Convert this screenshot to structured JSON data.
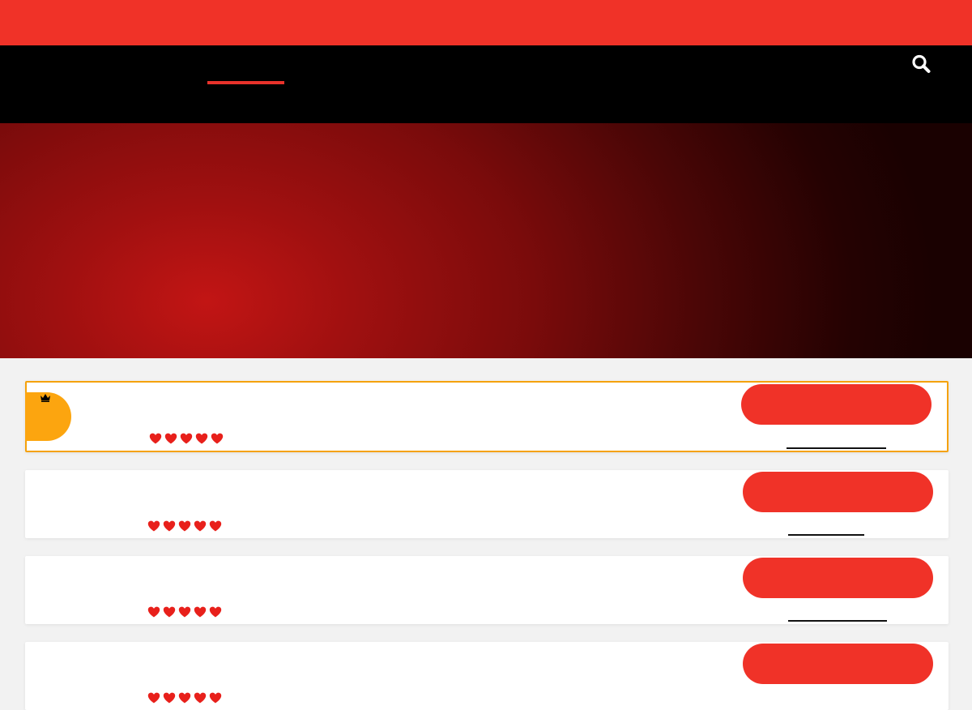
{
  "colors": {
    "brand_red": "#f03228",
    "nav_black": "#000000",
    "featured_gold": "#f5a20b",
    "badge_orange": "#fca50f",
    "heart_red": "#e8201b"
  },
  "header": {
    "search_icon": "search-icon"
  },
  "listings": [
    {
      "featured": true,
      "badge_icon": "crown-icon",
      "rating": 5,
      "rating_icon": "heart-icon"
    },
    {
      "featured": false,
      "rating": 5,
      "rating_icon": "heart-icon"
    },
    {
      "featured": false,
      "rating": 5,
      "rating_icon": "heart-icon"
    },
    {
      "featured": false,
      "rating": 5,
      "rating_icon": "heart-icon"
    }
  ]
}
